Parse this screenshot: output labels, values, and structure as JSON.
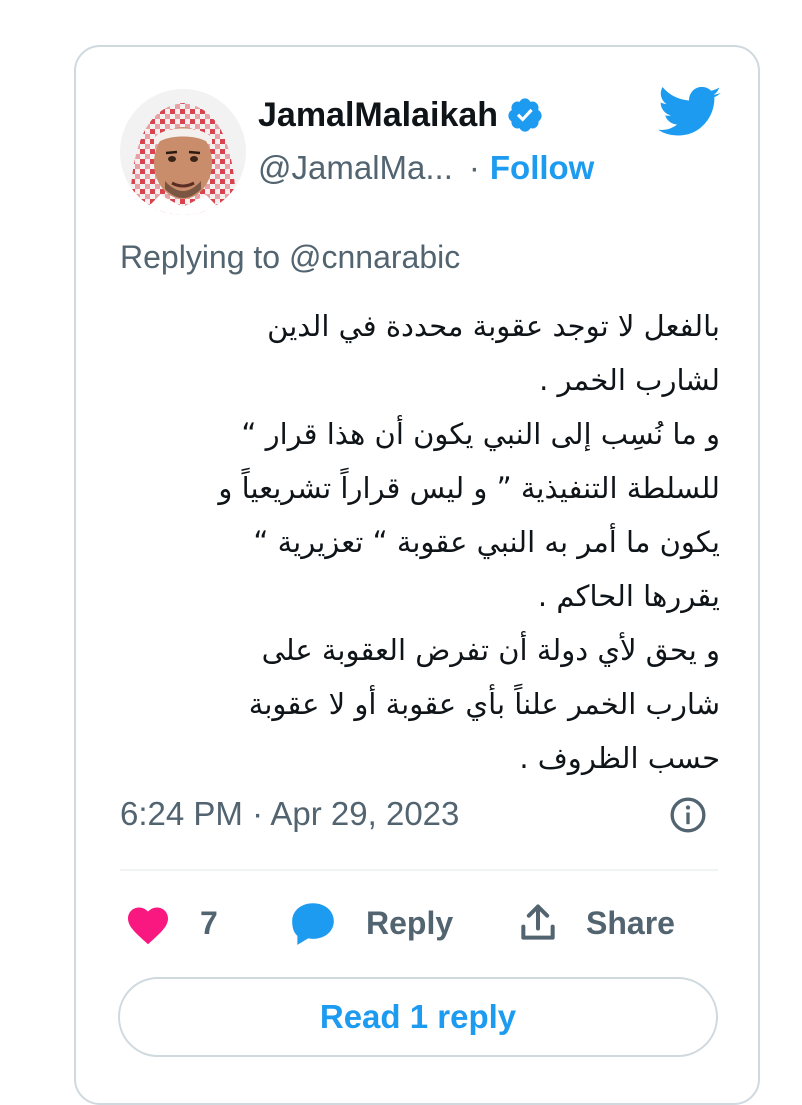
{
  "author": {
    "name": "JamalMalaikah",
    "handle": "@JamalMa...",
    "separator": "·",
    "follow_label": "Follow",
    "verified": true
  },
  "reply_context": "Replying to @cnnarabic",
  "body_text": "بالفعل لا توجد عقوبة محددة في الدين\nلشارب الخمر .\nو ما نُسِب إلى النبي يكون أن هذا قرار “\nللسلطة التنفيذية ” و ليس قراراً تشريعياً و\nيكون ما أمر به النبي عقوبة “ تعزيرية “\nيقررها الحاكم .\nو يحق لأي دولة أن تفرض العقوبة على\nشارب الخمر علناً بأي عقوبة أو لا عقوبة\nحسب الظروف .",
  "timestamp": "6:24 PM · Apr 29, 2023",
  "actions": {
    "like_count": "7",
    "reply_label": "Reply",
    "share_label": "Share"
  },
  "read_replies_label": "Read 1 reply",
  "colors": {
    "accent": "#1d9bf0",
    "like": "#f91880",
    "text": "#0f1419",
    "muted": "#536471",
    "border": "#cfd9de"
  },
  "icons": [
    "twitter-bird-icon",
    "verified-badge-icon",
    "info-icon",
    "heart-icon",
    "reply-bubble-icon",
    "share-icon"
  ]
}
